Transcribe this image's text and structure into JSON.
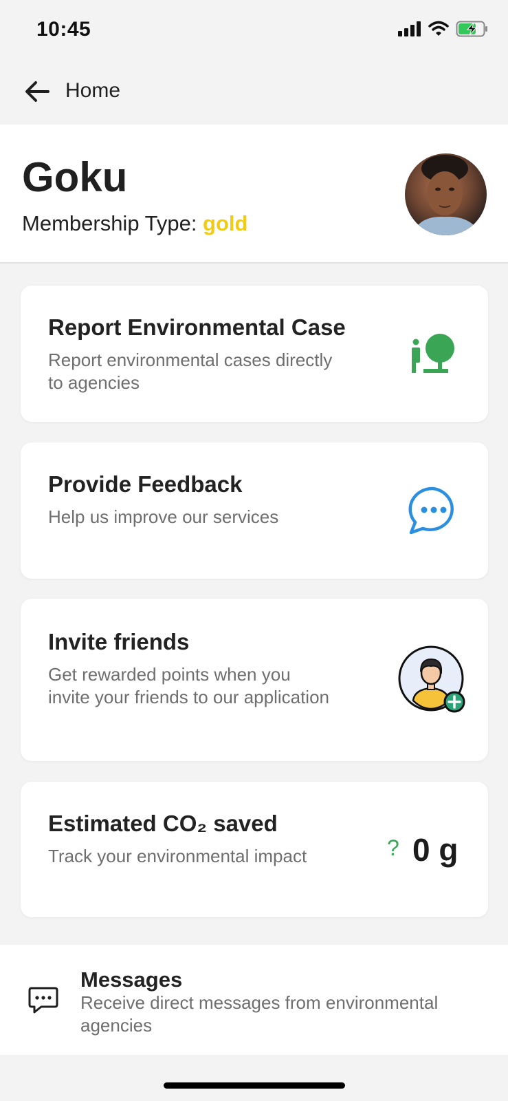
{
  "status_bar": {
    "time": "10:45"
  },
  "nav": {
    "title": "Home"
  },
  "profile": {
    "name": "Goku",
    "membership_label": "Membership Type: ",
    "membership_value": "gold",
    "accent_gold": "#f2cc12"
  },
  "cards": {
    "report": {
      "title": "Report Environmental Case",
      "description": "Report environmental cases directly to agencies",
      "icon": "tree-person-icon"
    },
    "feedback": {
      "title": "Provide Feedback",
      "description": "Help us improve our services",
      "icon": "chat-bubble-icon"
    },
    "invite": {
      "title": "Invite friends",
      "description": "Get rewarded points when you invite your friends to our application",
      "icon": "add-user-icon"
    },
    "co2": {
      "title": "Estimated CO₂ saved",
      "description": "Track your environmental impact",
      "help": "?",
      "value": "0 g"
    }
  },
  "messages": {
    "title": "Messages",
    "description": "Receive direct messages from environmental agencies",
    "icon": "message-icon"
  },
  "colors": {
    "green": "#3aa655",
    "blue": "#2a8fe0",
    "background": "#f3f3f3"
  }
}
